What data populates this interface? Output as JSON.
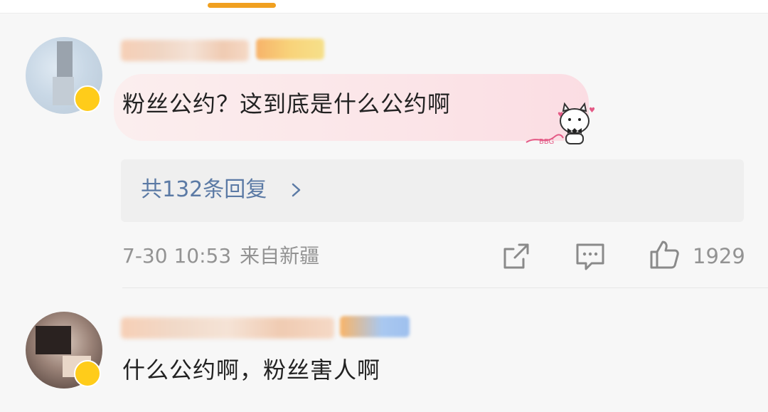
{
  "header": {
    "active_tab_color": "#f0a020"
  },
  "comments": [
    {
      "text": "粉丝公约？这到底是什么公约啊",
      "replies_label": "共132条回复",
      "time": "7-30 10:53",
      "location": "来自新疆",
      "likes": "1929"
    },
    {
      "text": "什么公约啊，粉丝害人啊"
    }
  ],
  "icons": {
    "share": "share-icon",
    "comment": "comment-icon",
    "like": "thumbs-up-icon",
    "chevron": "chevron-right-icon",
    "sticker": "cat-bowtie-sticker"
  },
  "colors": {
    "link": "#5b7aa5",
    "meta": "#939393",
    "text": "#222222",
    "bubble": "#fbe5e8",
    "vip_badge": "#ffcc1a"
  }
}
